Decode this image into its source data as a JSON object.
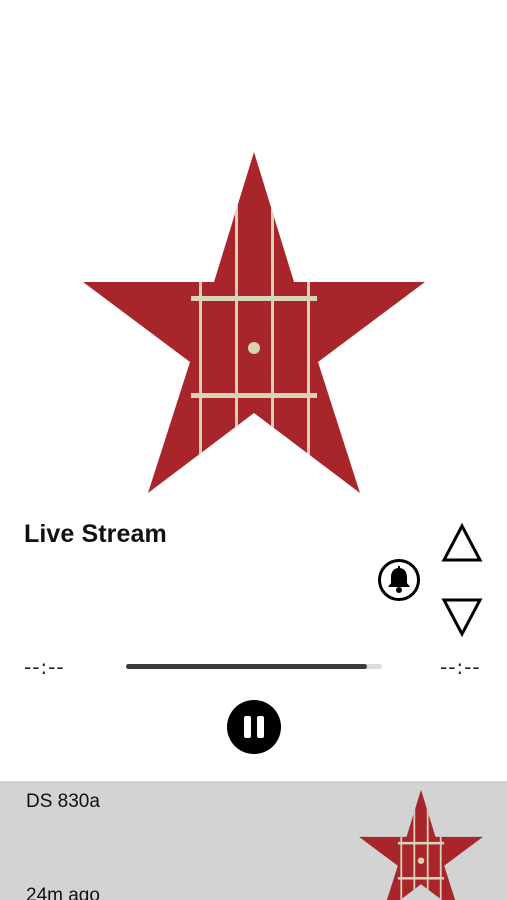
{
  "player": {
    "title": "Live Stream",
    "artwork_icon": "red-star-fretboard-logo",
    "notify_icon": "bell-icon",
    "vote_up_icon": "triangle-up-icon",
    "vote_down_icon": "triangle-down-icon",
    "elapsed": "--:--",
    "remaining": "--:--",
    "progress": 0.94,
    "pause_icon": "pause-icon"
  },
  "episodes": [
    {
      "title": "DS 830a",
      "time_ago": "24m ago",
      "thumb_icon": "red-star-fretboard-logo"
    }
  ],
  "colors": {
    "star": "#a8262b",
    "fret": "#d8d2b6",
    "background": "#ffffff",
    "row_background": "#d3d3d3",
    "progress_fill": "#3a3a3a",
    "progress_track": "#dcdcdc"
  }
}
